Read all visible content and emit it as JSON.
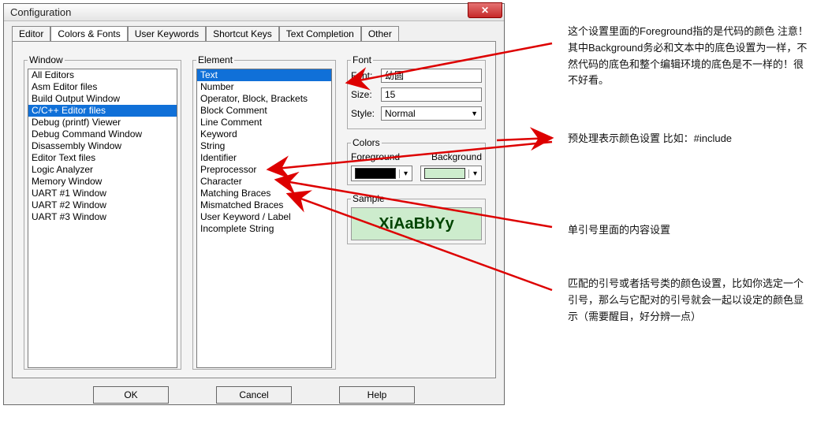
{
  "dialog": {
    "title": "Configuration"
  },
  "tabs": {
    "items": [
      {
        "label": "Editor"
      },
      {
        "label": "Colors & Fonts"
      },
      {
        "label": "User Keywords"
      },
      {
        "label": "Shortcut Keys"
      },
      {
        "label": "Text Completion"
      },
      {
        "label": "Other"
      }
    ],
    "active": 1
  },
  "window_group": {
    "legend": "Window",
    "items": [
      "All Editors",
      "Asm Editor files",
      "Build Output Window",
      "C/C++ Editor files",
      "Debug (printf) Viewer",
      "Debug Command Window",
      "Disassembly Window",
      "Editor Text files",
      "Logic Analyzer",
      "Memory Window",
      "UART #1 Window",
      "UART #2 Window",
      "UART #3 Window"
    ],
    "selected": 3
  },
  "element_group": {
    "legend": "Element",
    "items": [
      "Text",
      "Number",
      "Operator, Block, Brackets",
      "Block Comment",
      "Line Comment",
      "Keyword",
      "String",
      "Identifier",
      "Preprocessor",
      "Character",
      "Matching Braces",
      "Mismatched Braces",
      "User Keyword / Label",
      "Incomplete String"
    ],
    "selected": 0
  },
  "font_group": {
    "legend": "Font",
    "font_label": "Font:",
    "font_value": "幼圆",
    "size_label": "Size:",
    "size_value": "15",
    "style_label": "Style:",
    "style_value": "Normal"
  },
  "colors_group": {
    "legend": "Colors",
    "fg_label": "Foreground",
    "bg_label": "Background",
    "fg_color": "#000000",
    "bg_color": "#cdeccd"
  },
  "sample_group": {
    "legend": "Sample",
    "text": "XiAaBbYy"
  },
  "buttons": {
    "ok": "OK",
    "cancel": "Cancel",
    "help": "Help"
  },
  "annotations": {
    "a1": "这个设置里面的Foreground指的是代码的颜色 注意！其中Background务必和文本中的底色设置为一样，不然代码的底色和整个编辑环境的底色是不一样的！很不好看。",
    "a2": "预处理表示颜色设置  比如：#include",
    "a3": "单引号里面的内容设置",
    "a4": "匹配的引号或者括号类的颜色设置，比如你选定一个引号，那么与它配对的引号就会一起以设定的颜色显示（需要醒目，好分辨一点）"
  }
}
